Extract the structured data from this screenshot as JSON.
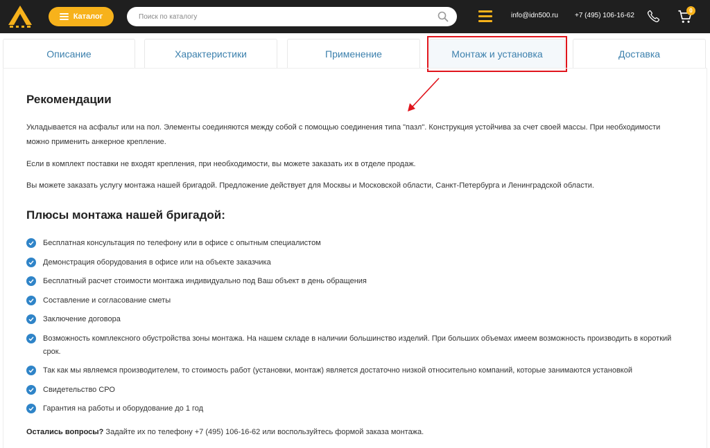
{
  "header": {
    "catalog_label": "Каталог",
    "search_placeholder": "Поиск по каталогу",
    "email": "info@idn500.ru",
    "phone": "+7 (495) 106-16-62",
    "cart_count": "0",
    "accent_color": "#f7b21b"
  },
  "tabs": [
    {
      "label": "Описание"
    },
    {
      "label": "Характеристики"
    },
    {
      "label": "Применение"
    },
    {
      "label": "Монтаж и установка",
      "active": true
    },
    {
      "label": "Доставка"
    }
  ],
  "content": {
    "rec_title": "Рекомендации",
    "paragraphs": [
      "Укладывается на асфальт или на пол. Элементы соединяются между собой с помощью соединения типа \"пазл\". Конструкция устойчива за счет своей массы. При необходимости можно применить анкерное крепление.",
      "Если в комплект поставки не входят крепления, при необходимости, вы можете заказать их в отделе продаж.",
      "Вы можете заказать услугу монтажа нашей бригадой. Предложение действует для Москвы и Московской области, Санкт-Петербурга и Ленинградской области."
    ],
    "pluses_title": "Плюсы монтажа нашей бригадой:",
    "pluses": [
      "Бесплатная консультация по телефону или в офисе с опытным специалистом",
      "Демонстрация оборудования в офисе или на объекте заказчика",
      "Бесплатный расчет стоимости монтажа индивидуально под Ваш объект в день обращения",
      "Составление и согласование сметы",
      "Заключение договора",
      "Возможность комплексного обустройства зоны монтажа. На нашем складе в наличии большинство изделий. При больших объемах имеем возможность производить в короткий срок.",
      "Так как мы являемся производителем, то стоимость работ (установки, монтаж) является достаточно низкой относительно компаний, которые занимаются установкой",
      "Свидетельство СРО",
      "Гарантия на работы и оборудование до 1 год"
    ],
    "questions_bold": "Остались вопросы?",
    "questions_text": " Задайте их по телефону +7 (495) 106-16-62 или воспользуйтесь формой заказа монтажа."
  }
}
